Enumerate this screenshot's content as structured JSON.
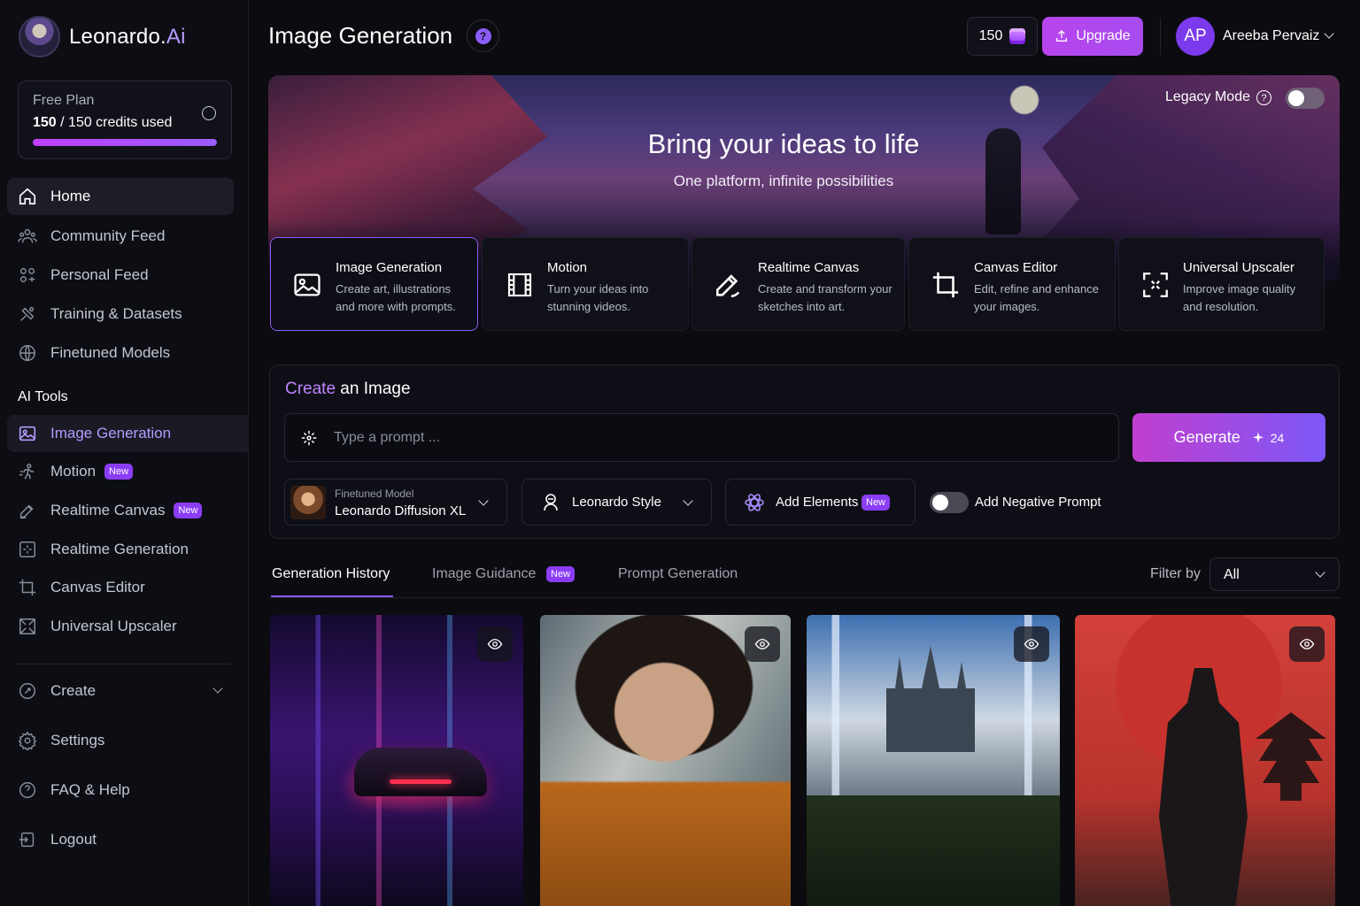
{
  "brand": {
    "name": "Leonardo.",
    "suffix": "Ai"
  },
  "plan": {
    "name": "Free Plan",
    "used": "150",
    "rest": " / 150 credits used",
    "usage_fraction": 1.0
  },
  "sidebar": {
    "main": [
      {
        "label": "Home",
        "icon": "home-icon"
      },
      {
        "label": "Community Feed",
        "icon": "community-icon"
      },
      {
        "label": "Personal Feed",
        "icon": "personal-feed-icon"
      },
      {
        "label": "Training & Datasets",
        "icon": "training-icon"
      },
      {
        "label": "Finetuned Models",
        "icon": "models-icon"
      }
    ],
    "tools_title": "AI Tools",
    "tools": [
      {
        "label": "Image Generation",
        "icon": "image-icon"
      },
      {
        "label": "Motion",
        "icon": "motion-icon",
        "badge": "New"
      },
      {
        "label": "Realtime Canvas",
        "icon": "realtime-canvas-icon",
        "badge": "New"
      },
      {
        "label": "Realtime Generation",
        "icon": "realtime-generation-icon"
      },
      {
        "label": "Canvas Editor",
        "icon": "crop-icon"
      },
      {
        "label": "Universal Upscaler",
        "icon": "upscale-icon"
      }
    ],
    "bottom": [
      {
        "label": "Create",
        "icon": "create-icon"
      },
      {
        "label": "Settings",
        "icon": "gear-icon"
      },
      {
        "label": "FAQ & Help",
        "icon": "help-icon"
      },
      {
        "label": "Logout",
        "icon": "logout-icon"
      }
    ]
  },
  "header": {
    "title": "Image Generation",
    "help": "?",
    "credits": "150",
    "upgrade": "Upgrade",
    "user_initials": "AP",
    "user_name": "Areeba Pervaiz"
  },
  "hero": {
    "title": "Bring your ideas to life",
    "subtitle": "One platform, infinite possibilities",
    "legacy_mode": "Legacy Mode",
    "legacy_on": false
  },
  "tool_cards": [
    {
      "title": "Image Generation",
      "desc": "Create art, illustrations and more with prompts.",
      "selected": true
    },
    {
      "title": "Motion",
      "desc": "Turn your ideas into stunning videos."
    },
    {
      "title": "Realtime Canvas",
      "desc": "Create and transform your sketches into art."
    },
    {
      "title": "Canvas Editor",
      "desc": "Edit, refine and enhance your images."
    },
    {
      "title": "Universal Upscaler",
      "desc": "Improve image quality and resolution."
    }
  ],
  "create": {
    "title_hi": "Create",
    "title_rest": " an Image",
    "prompt_placeholder": "Type a prompt ...",
    "generate": "Generate",
    "generate_cost": "24",
    "model_small": "Finetuned Model",
    "model_name": "Leonardo Diffusion XL",
    "style": "Leonardo Style",
    "elements": "Add Elements",
    "elements_badge": "New",
    "negative": "Add Negative Prompt",
    "negative_on": false
  },
  "tabs": [
    {
      "label": "Generation History",
      "active": true
    },
    {
      "label": "Image Guidance",
      "badge": "New"
    },
    {
      "label": "Prompt Generation"
    }
  ],
  "filter": {
    "label": "Filter by",
    "value": "All"
  },
  "gallery": [
    {
      "name": "cyberpunk-car"
    },
    {
      "name": "graffiti-girl"
    },
    {
      "name": "fantasy-castle"
    },
    {
      "name": "samurai"
    }
  ]
}
